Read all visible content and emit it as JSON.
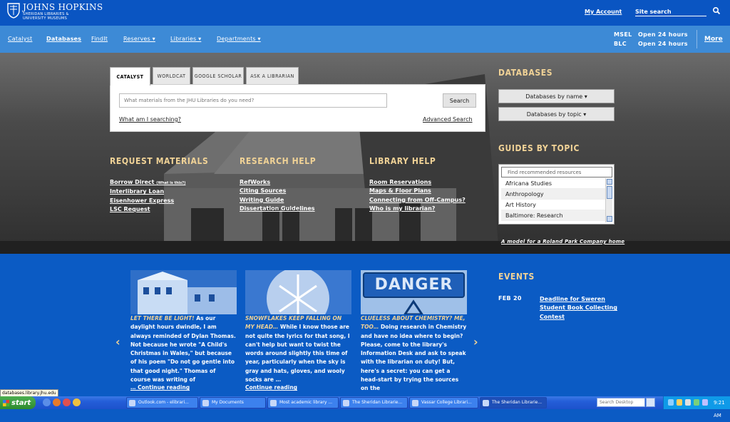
{
  "header": {
    "logo_line1": "JOHNS HOPKINS",
    "logo_line2": "SHERIDAN LIBRARIES &",
    "logo_line3": "UNIVERSITY MUSEUMS",
    "my_account": "My Account",
    "site_search_placeholder": "Site search"
  },
  "nav": {
    "items": [
      "Catalyst",
      "Databases",
      "FindIt",
      "Reserves ▾",
      "Libraries ▾",
      "Departments ▾"
    ],
    "hours": [
      {
        "place": "MSEL",
        "status": "Open 24 hours"
      },
      {
        "place": "BLC",
        "status": "Open 24 hours"
      }
    ],
    "more": "More"
  },
  "search": {
    "tabs": [
      "CATALYST",
      "WORLDCAT",
      "GOOGLE SCHOLAR",
      "ASK A LIBRARIAN"
    ],
    "active_tab": "CATALYST",
    "placeholder": "What materials from the JHU Libraries do you need?",
    "button": "Search",
    "what_link": "What am I searching?",
    "advanced_link": "Advanced Search"
  },
  "sections": {
    "request": {
      "title": "REQUEST MATERIALS",
      "links": [
        "Borrow Direct",
        "Interlibrary Loan",
        "Eisenhower Express",
        "LSC Request"
      ],
      "borrow_note": "(What is this?)"
    },
    "research": {
      "title": "RESEARCH HELP",
      "links": [
        "RefWorks",
        "Citing Sources",
        "Writing Guide",
        "Dissertation Guidelines"
      ]
    },
    "library": {
      "title": "LIBRARY HELP",
      "links": [
        "Room Reservations",
        "Maps & Floor Plans",
        "Connecting from Off-Campus?",
        "Who is my librarian?"
      ]
    }
  },
  "databases": {
    "title": "DATABASES",
    "by_name": "Databases by name ▾",
    "by_topic": "Databases by topic ▾"
  },
  "guides": {
    "title": "GUIDES BY TOPIC",
    "placeholder": "Find recommended resources",
    "items": [
      "Africana Studies",
      "Anthropology",
      "Art History",
      "Baltimore: Research"
    ]
  },
  "hero": {
    "caption": "A model for a Roland Park Company home"
  },
  "posts": [
    {
      "title": "LET THERE BE LIGHT!",
      "body": " As our daylight hours dwindle, I am always reminded of Dylan Thomas. Not because he wrote \"A Child's Christmas in Wales,\" but because of his poem \"Do not go gentle into that good night.\" Thomas of course was writing of",
      "more": "… Continue reading"
    },
    {
      "title": "SNOWFLAKES KEEP FALLING ON MY HEAD…",
      "body": " While I know those are not quite the lyrics for that song, I can't help but want to twist the words around slightly this time of year, particularly when the sky is gray and hats, gloves, and wooly socks are …",
      "more": "Continue reading"
    },
    {
      "title": "CLUELESS ABOUT CHEMISTRY? ME, TOO…",
      "body": " Doing research in Chemistry and have no idea where to begin? Please, come to the library's Information Desk and ask to speak with the librarian on duty! But, here's a secret: you can get a head-start by trying the sources on the",
      "more": "",
      "image_text": "DANGER"
    }
  ],
  "events": {
    "title": "EVENTS",
    "date": "FEB 20",
    "link": "Deadline for Sweren Student Book Collecting Contest"
  },
  "status_url": "databases.library.jhu.edu",
  "taskbar": {
    "start": "start",
    "tasks": [
      "Outlook.com - elibrari...",
      "My Documents",
      "Most academic library ...",
      "The Sheridan Librarie...",
      "Vassar College Librari...",
      "The Sheridan Librarie..."
    ],
    "search_placeholder": "Search Desktop",
    "clock": "9:21 AM"
  },
  "colors": {
    "top_bar": "#0a55c2",
    "nav_bar": "#3d8ad6",
    "accent_gold": "#f0d296",
    "blog_bg": "#0b5bc4"
  }
}
